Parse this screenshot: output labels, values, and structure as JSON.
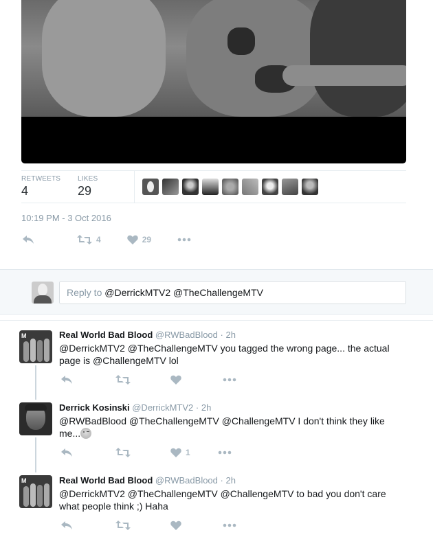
{
  "tweet": {
    "stats": {
      "retweets_label": "RETWEETS",
      "retweets_value": "4",
      "likes_label": "LIKES",
      "likes_value": "29"
    },
    "timestamp": "10:19 PM - 3 Oct 2016",
    "actions": {
      "retweet_count": "4",
      "like_count": "29"
    }
  },
  "composer": {
    "prefix": "Reply to ",
    "mentions": "@DerrickMTV2 @TheChallengeMTV"
  },
  "replies": [
    {
      "name": "Real World Bad Blood",
      "handle": "@RWBadBlood",
      "dot": "·",
      "time": "2h",
      "text": "@DerrickMTV2 @TheChallengeMTV you tagged the wrong page... the actual page is @ChallengeMTV lol",
      "like_count": ""
    },
    {
      "name": "Derrick Kosinski",
      "handle": "@DerrickMTV2",
      "dot": "·",
      "time": "2h",
      "text": "@RWBadBlood @TheChallengeMTV @ChallengeMTV I don't think they like me...",
      "like_count": "1"
    },
    {
      "name": "Real World Bad Blood",
      "handle": "@RWBadBlood",
      "dot": "·",
      "time": "2h",
      "text": "@DerrickMTV2 @TheChallengeMTV @ChallengeMTV to bad you don't care what people think ;) Haha",
      "like_count": ""
    }
  ],
  "icons": {
    "reply": "reply-icon",
    "retweet": "retweet-icon",
    "like": "heart-icon",
    "more": "more-icon"
  },
  "colors": {
    "icon_gray": "#aab8c2",
    "secondary_text": "#8899a6",
    "composer_bg": "#f5f8fa"
  }
}
